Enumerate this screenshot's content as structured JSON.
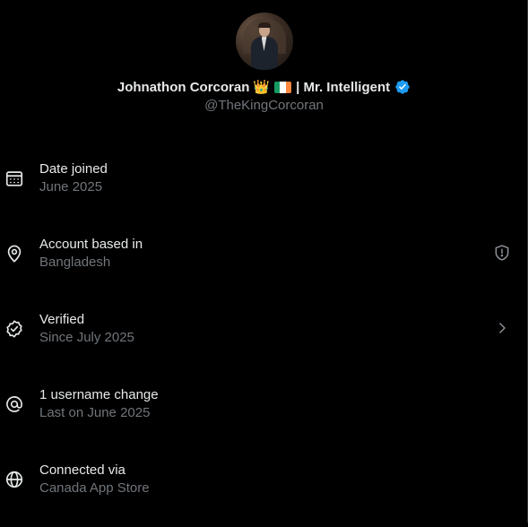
{
  "profile": {
    "name": "Johnathon Corcoran",
    "crown_emoji": "👑",
    "flag_name": "Ireland flag",
    "title": "| Mr. Intelligent",
    "handle": "@TheKingCorcoran"
  },
  "rows": [
    {
      "label": "Date joined",
      "value": "June 2025",
      "icon": "calendar-icon"
    },
    {
      "label": "Account based in",
      "value": "Bangladesh",
      "icon": "location-pin-icon",
      "trailing_icon": "shield-alert-icon"
    },
    {
      "label": "Verified",
      "value": "Since July 2025",
      "icon": "verified-badge-icon",
      "trailing_icon": "chevron-right-icon"
    },
    {
      "label": "1 username change",
      "value": "Last on June 2025",
      "icon": "at-sign-icon"
    },
    {
      "label": "Connected via",
      "value": "Canada App Store",
      "icon": "globe-icon"
    }
  ],
  "colors": {
    "background": "#000000",
    "primary_text": "#e7e9ea",
    "secondary_text": "#71767b",
    "verified_blue": "#1d9bf0",
    "flag": [
      "#169b62",
      "#ffffff",
      "#ff883e"
    ]
  }
}
